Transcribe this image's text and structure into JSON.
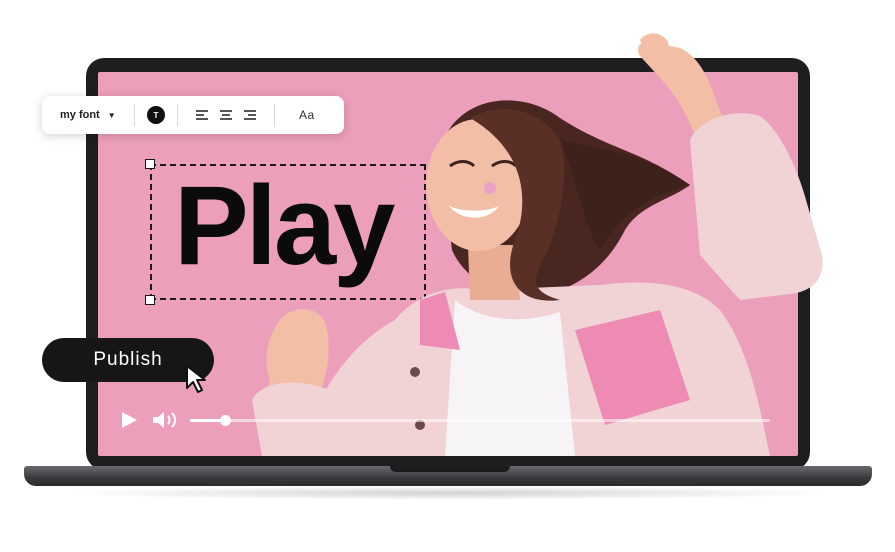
{
  "editor": {
    "headline": "Play",
    "toolbar": {
      "font_name": "my font",
      "text_color_label": "T",
      "case_label": "Aa",
      "align_options": [
        "align-left",
        "align-center",
        "align-right"
      ]
    },
    "publish_label": "Publish"
  },
  "player": {
    "progress": 0.06
  },
  "colors": {
    "screen_bg": "#ec9fbb",
    "laptop": "#1e1e20",
    "jacket": "#f1d3d6",
    "jacket_pink": "#ee8bb4",
    "hair": "#4a2620",
    "skin": "#f2bfa6"
  },
  "icons": [
    "caret-down-icon",
    "align-left-icon",
    "align-center-icon",
    "align-right-icon",
    "play-icon",
    "volume-icon",
    "cursor-icon"
  ]
}
